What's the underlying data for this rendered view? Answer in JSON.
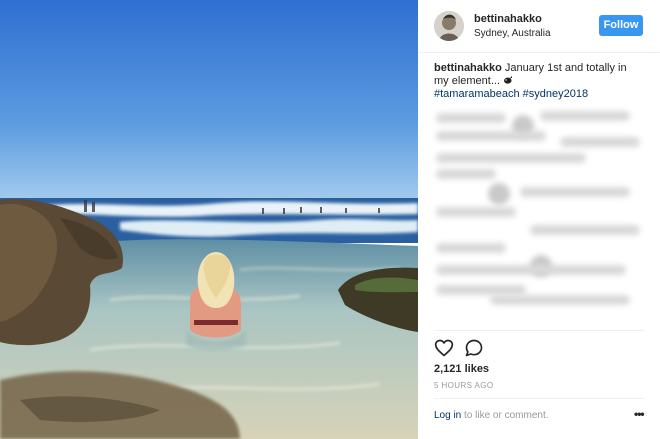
{
  "post": {
    "username": "bettinahakko",
    "location": "Sydney, Australia",
    "follow_label": "Follow",
    "caption_user": "bettinahakko",
    "caption_text": "January 1st and totally in my element...",
    "hashtags": "#tamaramabeach #sydney2018",
    "likes": "2,121 likes",
    "time": "5 HOURS AGO",
    "login_link": "Log in",
    "login_rest": "to like or comment.",
    "more_label": "•••"
  },
  "icons": {
    "like": "heart-icon",
    "comment": "comment-icon",
    "emoji": "whale-emoji-icon"
  },
  "colors": {
    "follow_button": "#3897f0",
    "hashtag": "#003569",
    "sky_top": "#2f6fd1",
    "sky_bottom": "#9cc6ec",
    "sea": "#2a5fa0"
  }
}
